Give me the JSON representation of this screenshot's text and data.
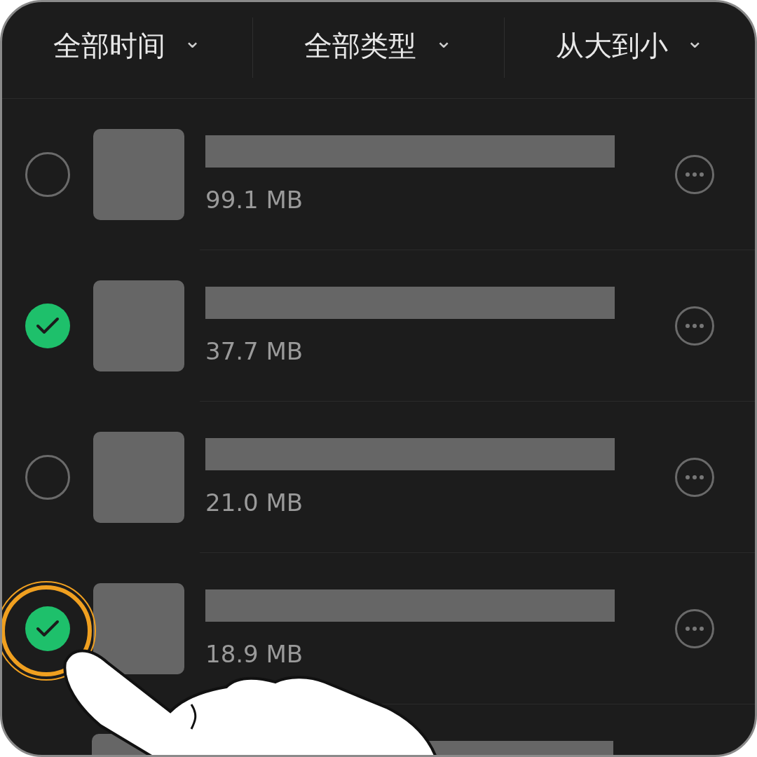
{
  "filters": [
    {
      "label": "全部时间",
      "symbol": "⌄"
    },
    {
      "label": "全部类型",
      "symbol": "⌄"
    },
    {
      "label": "从大到小",
      "symbol": "⌄"
    }
  ],
  "files": [
    {
      "kind": "full",
      "size": "99.1 MB",
      "selected": false
    },
    {
      "kind": "full",
      "size": "37.7 MB",
      "selected": true
    },
    {
      "kind": "full",
      "size": "21.0 MB",
      "selected": false
    },
    {
      "kind": "full",
      "size": "18.9 MB",
      "selected": true
    },
    {
      "kind": "partial"
    }
  ],
  "tap_hint": {
    "shown": true
  }
}
